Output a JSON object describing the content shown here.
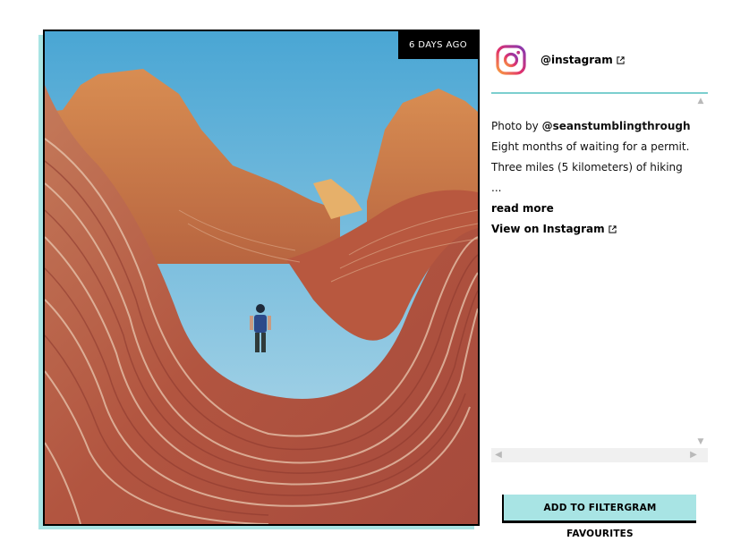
{
  "photo": {
    "age_badge": "6 DAYS AGO"
  },
  "profile": {
    "handle": "@instagram",
    "logo_icon": "instagram-logo-icon",
    "external_icon": "external-link-icon"
  },
  "caption": {
    "prefix": "Photo by ",
    "author": "@seanstumblingthrough",
    "line1": "Eight months of waiting for a permit.",
    "line2": "Three miles (5 kilometers) of hiking ...",
    "read_more": "read more"
  },
  "view_on_instagram": "View on Instagram",
  "favourites_button": "ADD TO FILTERGRAM FAVOURITES",
  "colors": {
    "accent": "#a8e4e4",
    "divider": "#7ccfcf"
  }
}
